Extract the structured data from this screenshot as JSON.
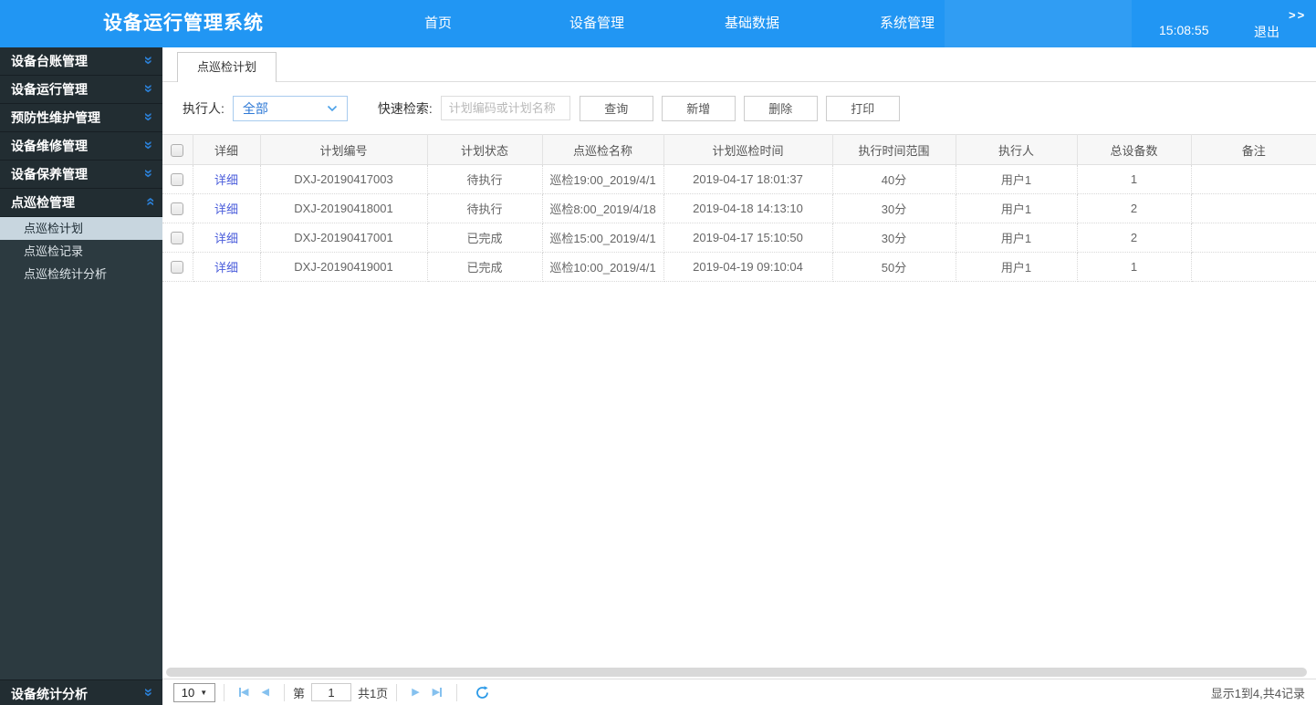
{
  "navbar": {
    "title": "设备运行管理系统",
    "menu": [
      "首页",
      "设备管理",
      "基础数据",
      "系统管理"
    ],
    "clock": "15:08:55",
    "logout": "退出",
    "collapse": ">>"
  },
  "sidebar": {
    "groups": [
      {
        "label": "设备台账管理"
      },
      {
        "label": "设备运行管理"
      },
      {
        "label": "预防性维护管理"
      },
      {
        "label": "设备维修管理"
      },
      {
        "label": "设备保养管理"
      },
      {
        "label": "点巡检管理",
        "expanded": true,
        "children": [
          {
            "label": "点巡检计划",
            "active": true
          },
          {
            "label": "点巡检记录"
          },
          {
            "label": "点巡检统计分析"
          }
        ]
      },
      {
        "label": "设备统计分析"
      }
    ]
  },
  "tab": {
    "label": "点巡检计划"
  },
  "filter": {
    "executor_label": "执行人:",
    "executor_value": "全部",
    "search_label": "快速检索:",
    "search_placeholder": "计划编码或计划名称",
    "buttons": [
      "查询",
      "新增",
      "删除",
      "打印"
    ]
  },
  "table": {
    "headers": {
      "detail": "详细",
      "plan_no": "计划编号",
      "status": "计划状态",
      "name": "点巡检名称",
      "time": "计划巡检时间",
      "range": "执行时间范围",
      "executor": "执行人",
      "count": "总设备数",
      "remark": "备注"
    },
    "rows": [
      {
        "detail": "详细",
        "plan_no": "DXJ-20190417003",
        "status": "待执行",
        "name": "巡检19:00_2019/4/1",
        "time": "2019-04-17 18:01:37",
        "range": "40分",
        "executor": "用户1",
        "count": "1",
        "remark": ""
      },
      {
        "detail": "详细",
        "plan_no": "DXJ-20190418001",
        "status": "待执行",
        "name": "巡检8:00_2019/4/18",
        "time": "2019-04-18 14:13:10",
        "range": "30分",
        "executor": "用户1",
        "count": "2",
        "remark": ""
      },
      {
        "detail": "详细",
        "plan_no": "DXJ-20190417001",
        "status": "已完成",
        "name": "巡检15:00_2019/4/1",
        "time": "2019-04-17 15:10:50",
        "range": "30分",
        "executor": "用户1",
        "count": "2",
        "remark": ""
      },
      {
        "detail": "详细",
        "plan_no": "DXJ-20190419001",
        "status": "已完成",
        "name": "巡检10:00_2019/4/1",
        "time": "2019-04-19 09:10:04",
        "range": "50分",
        "executor": "用户1",
        "count": "1",
        "remark": ""
      }
    ]
  },
  "pagination": {
    "page_size": "10",
    "page_prefix": "第",
    "page_value": "1",
    "page_suffix": "共1页",
    "summary": "显示1到4,共4记录"
  },
  "colors": {
    "navbar_blue": "#2196f3",
    "sidebar_dark": "#222d32",
    "submenu_dark": "#2c3a40",
    "active_item_bg": "#c8d6df",
    "chevron_blue": "#2b7ed3",
    "link_blue": "#4a5cdb",
    "select_blue": "#2f7ad6",
    "pager_light_blue": "#85c1ef",
    "refresh_blue": "#2b9ae8"
  }
}
